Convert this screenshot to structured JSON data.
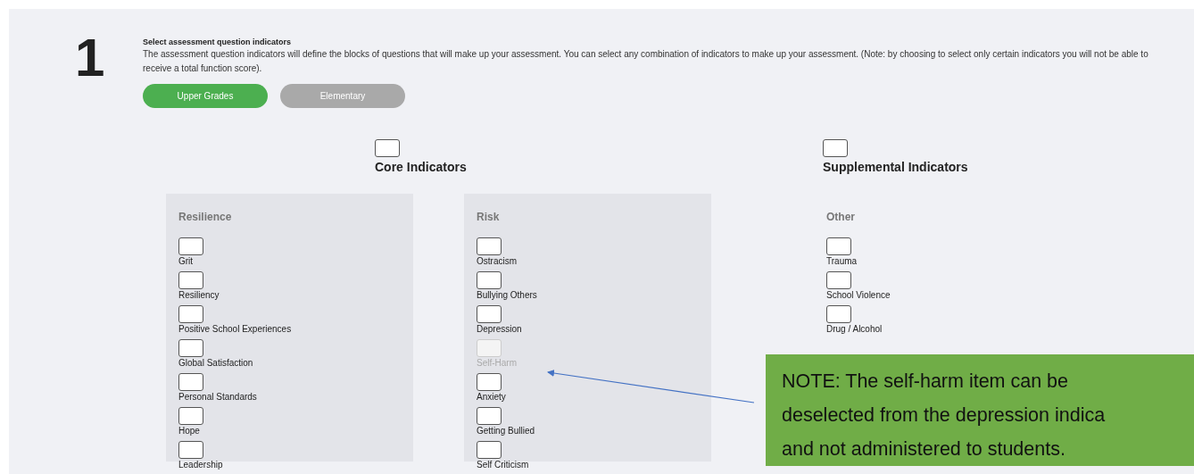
{
  "step": {
    "number": "1",
    "title": "Select assessment question indicators",
    "description": "The assessment question indicators will define the blocks of questions that will make up your assessment. You can select any combination of indicators to make up your assessment. (Note: by choosing to select only certain indicators you will not be able to receive a total function score)."
  },
  "grade_buttons": [
    {
      "label": "Upper Grades",
      "selected": true
    },
    {
      "label": "Elementary",
      "selected": false
    }
  ],
  "sections": [
    {
      "title": "Core Indicators",
      "checked": false,
      "groups": [
        {
          "heading": "Resilience",
          "shaded": true,
          "items": [
            {
              "label": "Grit",
              "checked": false,
              "disabled": false
            },
            {
              "label": "Resiliency",
              "checked": false,
              "disabled": false
            },
            {
              "label": "Positive School Experiences",
              "checked": false,
              "disabled": false
            },
            {
              "label": "Global Satisfaction",
              "checked": false,
              "disabled": false
            },
            {
              "label": "Personal Standards",
              "checked": false,
              "disabled": false
            },
            {
              "label": "Hope",
              "checked": false,
              "disabled": false
            },
            {
              "label": "Leadership",
              "checked": false,
              "disabled": false
            }
          ]
        },
        {
          "heading": "Risk",
          "shaded": true,
          "items": [
            {
              "label": "Ostracism",
              "checked": false,
              "disabled": false
            },
            {
              "label": "Bullying Others",
              "checked": false,
              "disabled": false
            },
            {
              "label": "Depression",
              "checked": false,
              "disabled": false
            },
            {
              "label": "Self-Harm",
              "checked": false,
              "disabled": true
            },
            {
              "label": "Anxiety",
              "checked": false,
              "disabled": false
            },
            {
              "label": "Getting Bullied",
              "checked": false,
              "disabled": false
            },
            {
              "label": "Self Criticism",
              "checked": false,
              "disabled": false
            }
          ]
        }
      ]
    },
    {
      "title": "Supplemental Indicators",
      "checked": false,
      "groups": [
        {
          "heading": "Other",
          "shaded": false,
          "items": [
            {
              "label": "Trauma",
              "checked": false,
              "disabled": false
            },
            {
              "label": "School Violence",
              "checked": false,
              "disabled": false
            },
            {
              "label": "Drug / Alcohol",
              "checked": false,
              "disabled": false
            }
          ]
        }
      ]
    }
  ],
  "note": {
    "lines": [
      "NOTE: The self-harm item can be",
      "deselected from the depression indica",
      "and not administered to students."
    ]
  }
}
